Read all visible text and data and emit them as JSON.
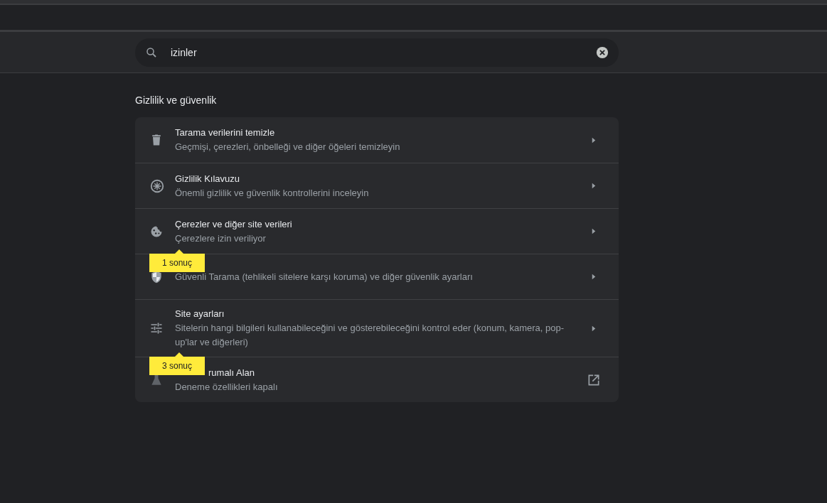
{
  "search": {
    "value": "izinler"
  },
  "section": {
    "title": "Gizlilik ve güvenlik"
  },
  "items": [
    {
      "kind": "trash",
      "title": "Tarama verilerini temizle",
      "subtitle": "Geçmişi, çerezleri, önbelleği ve diğer öğeleri temizleyin",
      "external": false
    },
    {
      "kind": "compass",
      "title": "Gizlilik Kılavuzu",
      "subtitle": "Önemli gizlilik ve güvenlik kontrollerini inceleyin",
      "external": false
    },
    {
      "kind": "cookie",
      "title": "Çerezler ve diğer site verileri",
      "subtitle": "Çerezlere izin veriliyor",
      "external": false,
      "badge": "1 sonuç"
    },
    {
      "kind": "shield",
      "subtitle": "Güvenli Tarama (tehlikeli sitelere karşı koruma) ve diğer güvenlik ayarları",
      "external": false
    },
    {
      "kind": "tune",
      "title": "Site ayarları",
      "subtitle": "Sitelerin hangi bilgileri kullanabileceğini ve gösterebileceğini kontrol eder (konum, kamera, pop-up'lar ve diğerleri)",
      "external": false,
      "badge": "3 sonuç"
    },
    {
      "kind": "flask",
      "title": "rumalı Alan",
      "subtitle": "Deneme özellikleri kapalı",
      "external": true
    }
  ]
}
